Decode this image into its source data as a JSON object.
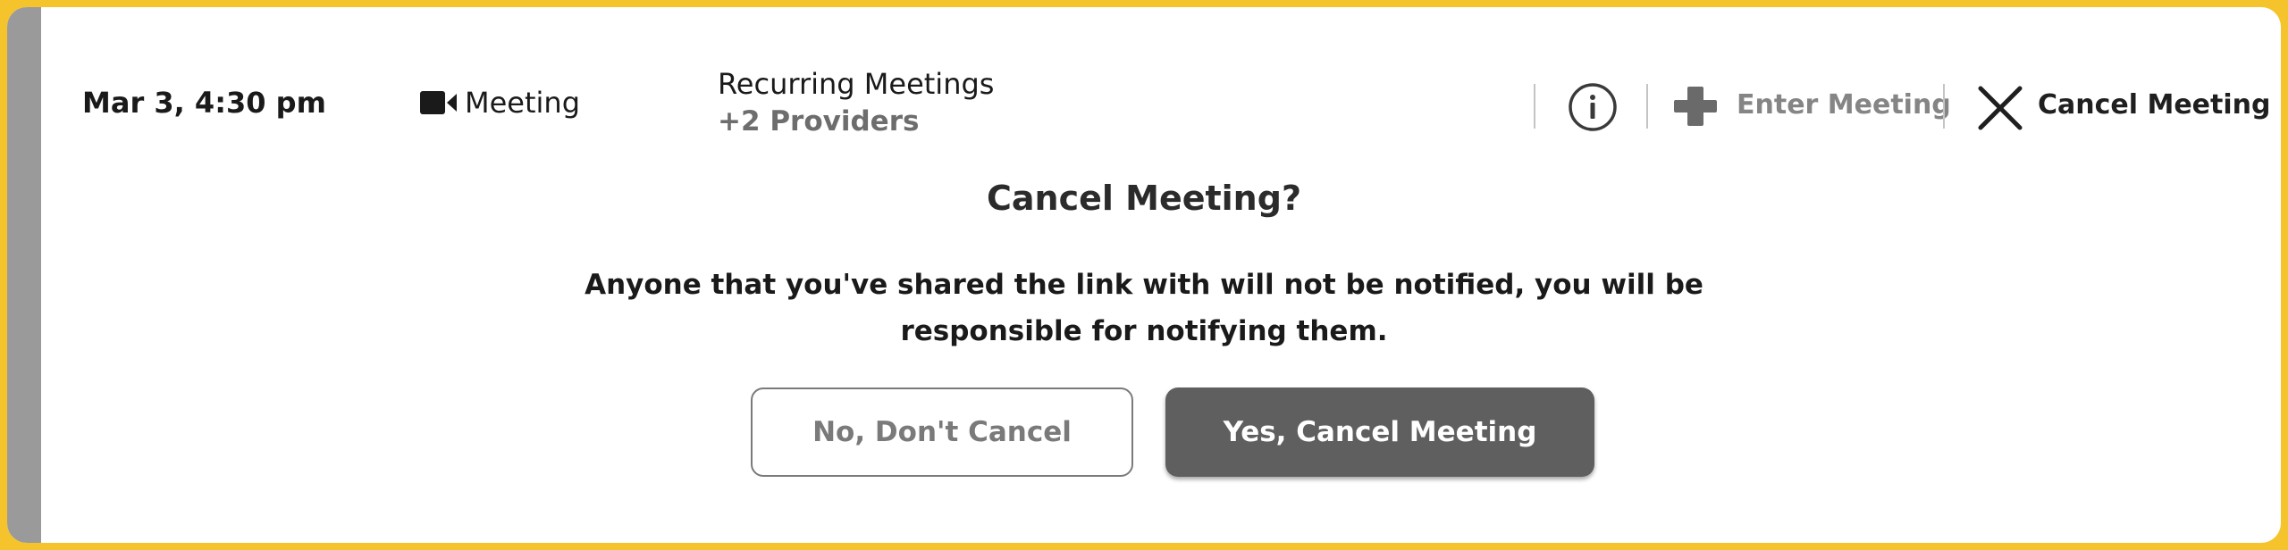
{
  "colors": {
    "frame": "#f5c42c",
    "accent_bar": "#9a9a9a",
    "primary_button": "#5f5f5f",
    "muted_text": "#858585"
  },
  "appointment": {
    "datetime": "Mar 3, 4:30 pm",
    "type_icon": "video-camera-icon",
    "type_label": "Meeting",
    "title": "Recurring Meetings",
    "providers": "+2 Providers"
  },
  "actions": {
    "info_icon": "info-icon",
    "enter_icon": "plus-icon",
    "enter_label": "Enter Meeting",
    "cancel_icon": "close-icon",
    "cancel_label": "Cancel Meeting"
  },
  "dialog": {
    "title": "Cancel Meeting?",
    "message_line1": "Anyone that you've shared the link with will not be notified, you will be",
    "message_line2": "responsible for notifying them.",
    "secondary_button": "No, Don't Cancel",
    "primary_button": "Yes, Cancel Meeting"
  }
}
